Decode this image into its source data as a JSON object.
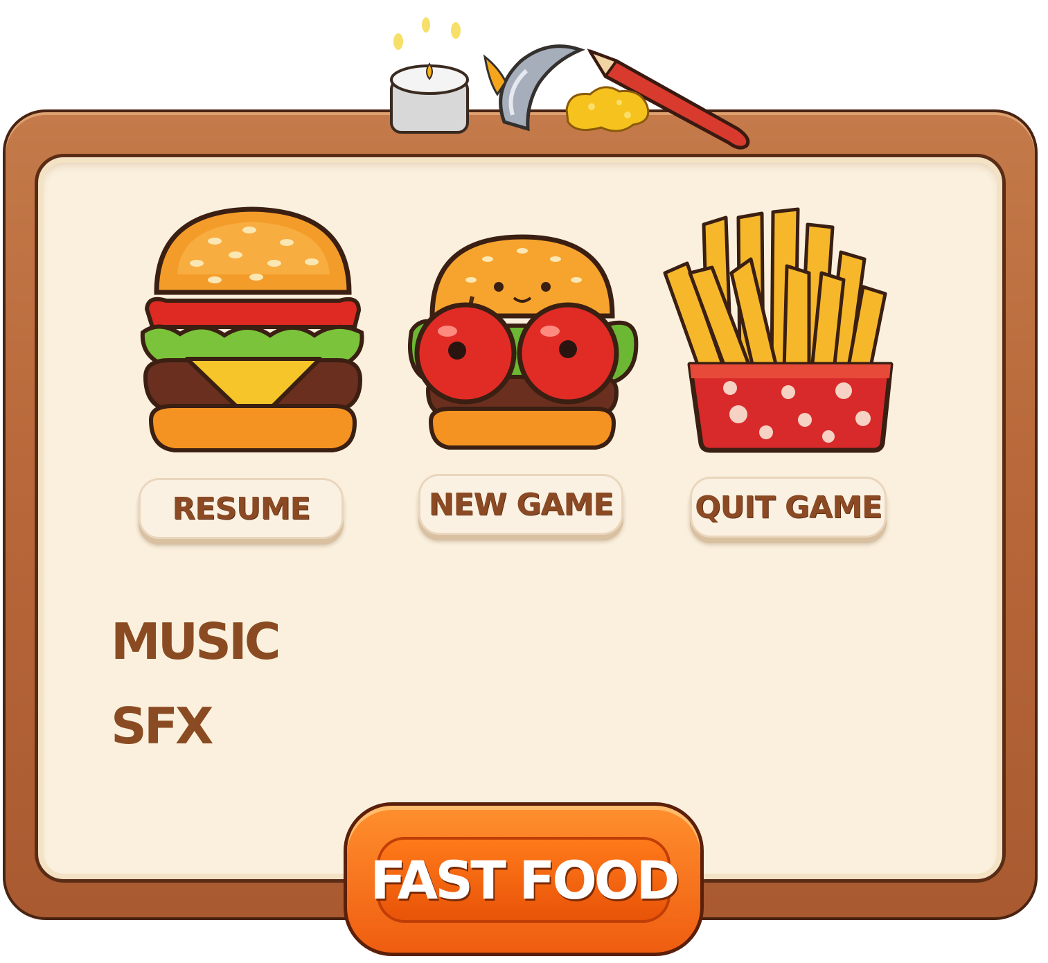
{
  "menu": {
    "buttons": [
      {
        "label": "RESUME",
        "icon": "cheeseburger-icon"
      },
      {
        "label": "NEW GAME",
        "icon": "cherry-burger-icon"
      },
      {
        "label": "QUIT GAME",
        "icon": "french-fries-icon"
      }
    ]
  },
  "settings": {
    "music_label": "MUSIC",
    "sfx_label": "SFX"
  },
  "title": {
    "text": "FAST FOOD"
  },
  "decorations": [
    "candle-icon",
    "knife-icon",
    "pencil-icon",
    "cheese-icon"
  ],
  "colors": {
    "frame_wood": "#b8683a",
    "panel_bg": "#faf0dd",
    "label_brown": "#8a4b22",
    "title_orange": "#ef5d10"
  }
}
